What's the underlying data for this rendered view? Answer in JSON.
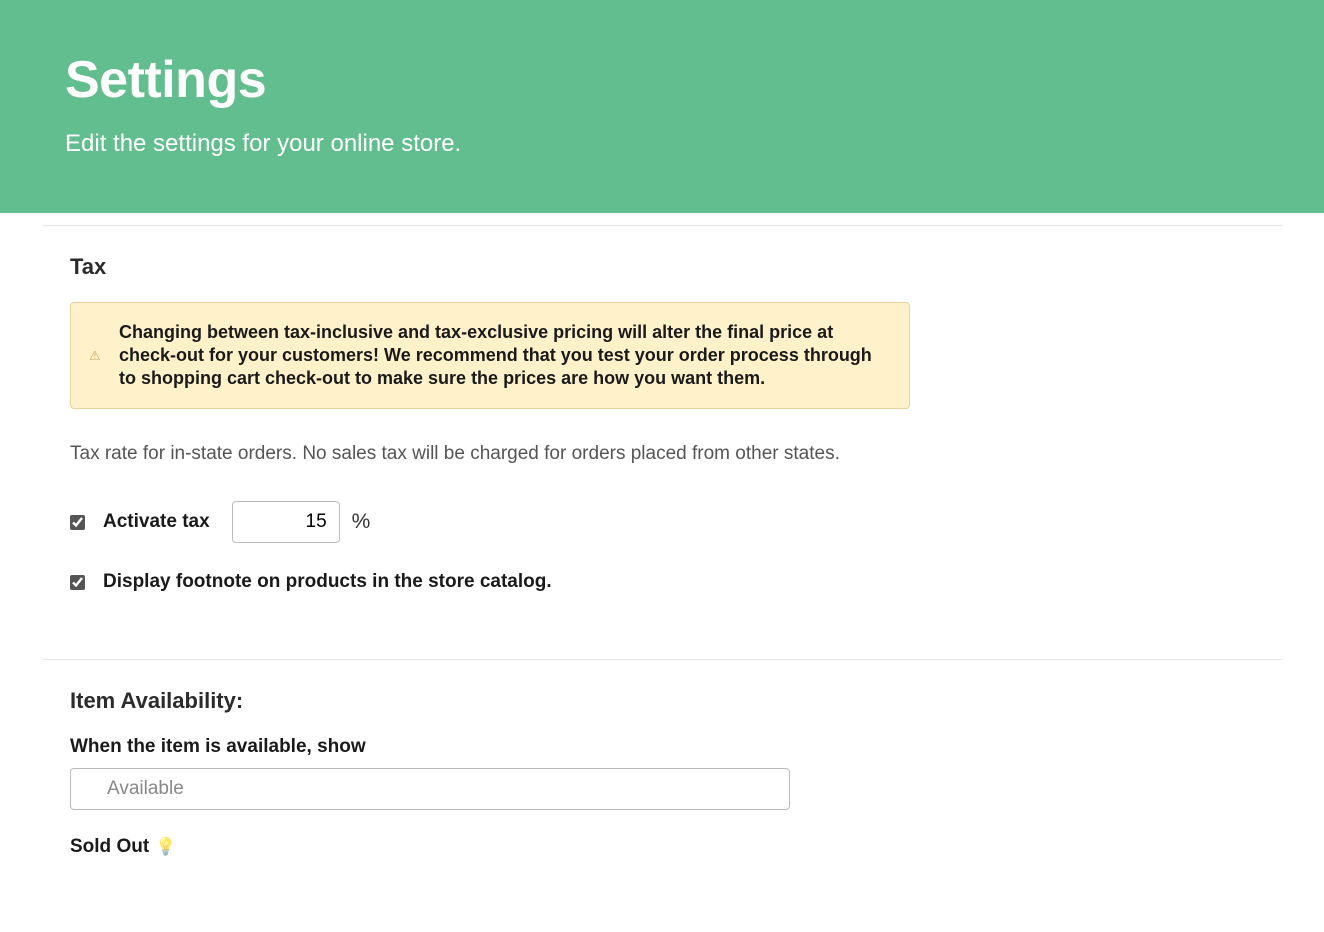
{
  "header": {
    "title": "Settings",
    "subtitle": "Edit the settings for your online store."
  },
  "tax": {
    "heading": "Tax",
    "warning": "Changing between tax-inclusive and tax-exclusive pricing will alter the final price at check-out for your customers! We recommend that you test your order process through to shopping cart check-out to make sure the prices are how you want them.",
    "description": "Tax rate for in-state orders. No sales tax will be charged for orders placed from other states.",
    "activate_label": "Activate tax",
    "rate_value": "15",
    "percent_symbol": "%",
    "footnote_label": "Display footnote on products in the store catalog."
  },
  "availability": {
    "heading": "Item Availability:",
    "available_label": "When the item is available, show",
    "available_value": "Available",
    "soldout_label": "Sold Out"
  }
}
